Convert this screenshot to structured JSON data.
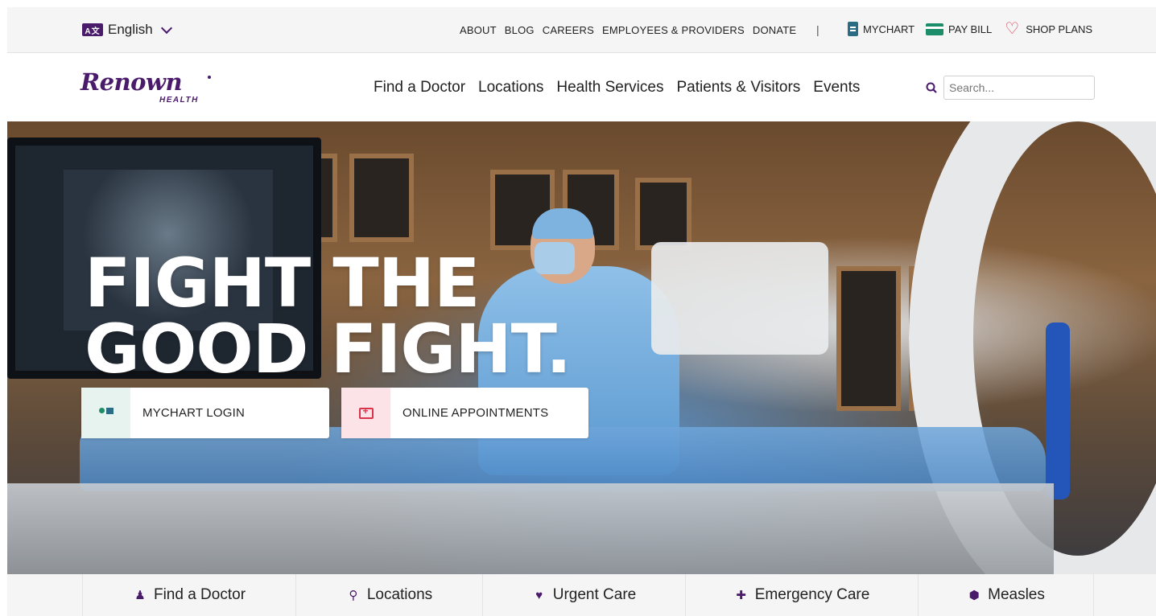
{
  "utility_bar": {
    "language": "English",
    "links": [
      "ABOUT",
      "BLOG",
      "CAREERS",
      "EMPLOYEES & PROVIDERS",
      "DONATE"
    ],
    "separator": "|",
    "mychart": "MYCHART",
    "pay_bill": "PAY BILL",
    "shop_plans": "SHOP PLANS"
  },
  "header": {
    "logo_word": "Renown",
    "logo_sub": "HEALTH",
    "nav": [
      "Find a Doctor",
      "Locations",
      "Health Services",
      "Patients & Visitors",
      "Events"
    ],
    "search_placeholder": "Search..."
  },
  "hero": {
    "title_line1": "FIGHT THE",
    "title_line2": "GOOD FIGHT.",
    "cta_mychart": "MYCHART LOGIN",
    "cta_appointments": "ONLINE APPOINTMENTS"
  },
  "quick_links": [
    {
      "label": "Find a Doctor",
      "icon": "doctor-icon"
    },
    {
      "label": "Locations",
      "icon": "map-pin-icon"
    },
    {
      "label": "Urgent Care",
      "icon": "heartbeat-icon"
    },
    {
      "label": "Emergency Care",
      "icon": "ambulance-icon"
    },
    {
      "label": "Measles",
      "icon": "virus-shield-icon"
    }
  ],
  "colors": {
    "brand_purple": "#4a1a6b",
    "accent_red": "#d9344a",
    "accent_green": "#1d8c68",
    "accent_teal": "#2a6b86"
  }
}
